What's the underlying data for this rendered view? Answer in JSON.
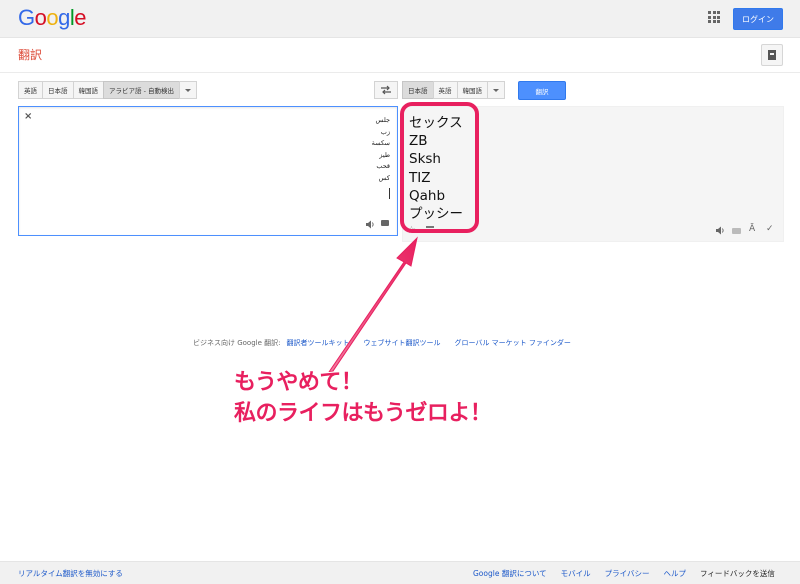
{
  "header": {
    "logo_letters": [
      {
        "ch": "G",
        "color": "#3369e8"
      },
      {
        "ch": "o",
        "color": "#d50f25"
      },
      {
        "ch": "o",
        "color": "#eeb211"
      },
      {
        "ch": "g",
        "color": "#3369e8"
      },
      {
        "ch": "l",
        "color": "#009925"
      },
      {
        "ch": "e",
        "color": "#d50f25"
      }
    ],
    "login_label": "ログイン"
  },
  "page": {
    "title": "翻訳"
  },
  "source_langs": [
    {
      "label": "英語",
      "active": false
    },
    {
      "label": "日本語",
      "active": false
    },
    {
      "label": "韓国語",
      "active": false
    },
    {
      "label": "アラビア語 - 自動検出",
      "active": true
    }
  ],
  "target_langs": [
    {
      "label": "日本語",
      "active": true
    },
    {
      "label": "英語",
      "active": false
    },
    {
      "label": "韓国語",
      "active": false
    }
  ],
  "translate_label": "翻訳",
  "source": {
    "clear_glyph": "×",
    "lines": [
      "جلس",
      "زب",
      "سكسة",
      "طيز",
      "قحب",
      "كس"
    ]
  },
  "result": {
    "lines": [
      "セックス",
      "ZB",
      "Sksh",
      "TIZ",
      "Qahb",
      "プッシー"
    ]
  },
  "annotation": {
    "lines": [
      "もうやめて！",
      "私のライフはもうゼロよ！"
    ],
    "color": "#e8205f"
  },
  "business": {
    "prefix": "ビジネス向け Google 翻訳:",
    "links": [
      "翻訳者ツールキット",
      "ウェブサイト翻訳ツール",
      "グローバル マーケット ファインダー"
    ]
  },
  "footer": {
    "realtime_label": "リアルタイム翻訳を無効にする",
    "links": [
      "Google 翻訳について",
      "モバイル",
      "プライバシー",
      "ヘルプ"
    ],
    "feedback_label": "フィードバックを送信"
  },
  "icons": {
    "swap": "swap-languages-icon",
    "speaker": "speaker-icon",
    "star": "star-icon",
    "list": "list-icon",
    "phonetic": "phonetic-icon",
    "check": "check-icon"
  }
}
